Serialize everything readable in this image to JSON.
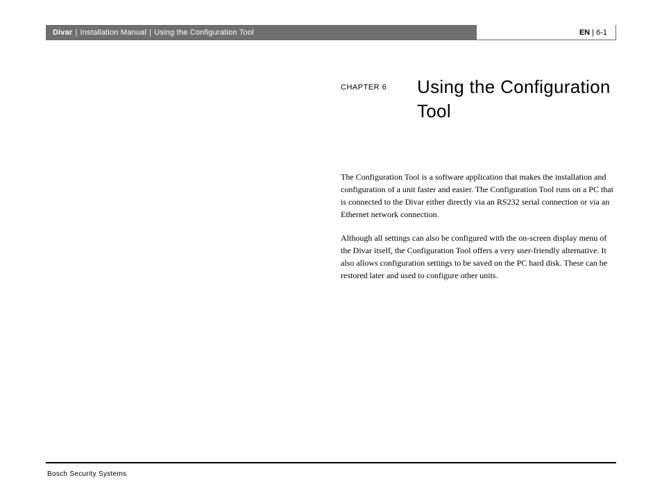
{
  "header": {
    "product": "Divar",
    "manual": "Installation Manual",
    "section": "Using the Configuration Tool",
    "lang": "EN",
    "page_ref": "6-1"
  },
  "chapter": {
    "label": "CHAPTER 6",
    "title": "Using the Configuration Tool"
  },
  "body": {
    "p1": "The Configuration Tool is a software application that makes the installation and configuration of a unit faster and easier. The Configuration Tool runs on a PC that is connected to the Divar either directly via an RS232 serial connection or via an Ethernet network connection.",
    "p2": "Although all settings can also be configured with the on-screen display menu of the Divar itself, the Configuration Tool offers a very user-friendly alternative. It also allows configuration settings to be saved on the PC hard disk. These can be restored later and used to configure other units."
  },
  "footer": {
    "company": "Bosch Security Systems"
  }
}
